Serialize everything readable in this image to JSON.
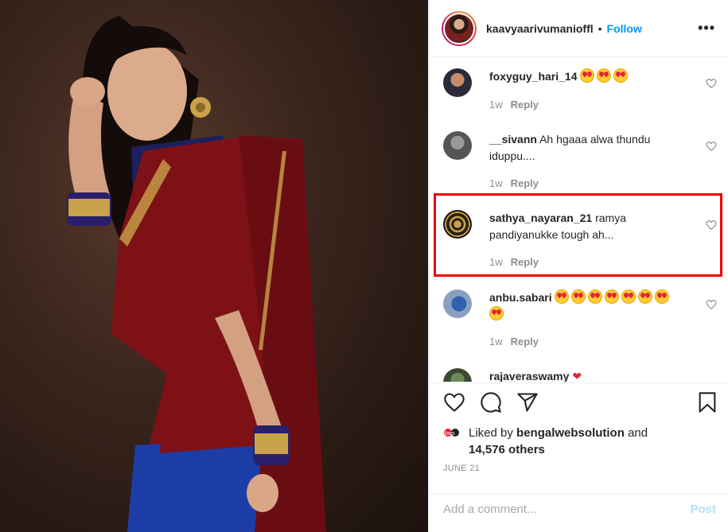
{
  "post": {
    "username": "kaavyaarivumanioffl",
    "separator": "•",
    "follow_label": "Follow",
    "more_label": "•••"
  },
  "comments": [
    {
      "username": "foxyguy_hari_14",
      "text": "",
      "emoji_count": 3,
      "time": "1w",
      "reply_label": "Reply"
    },
    {
      "username": "__sivann",
      "text": "Ah hgaaa alwa thundu iduppu....",
      "emoji_count": 0,
      "time": "1w",
      "reply_label": "Reply"
    },
    {
      "username": "sathya_nayaran_21",
      "text": "ramya pandiyanukke tough ah...",
      "emoji_count": 0,
      "time": "1w",
      "reply_label": "Reply",
      "highlighted": true
    },
    {
      "username": "anbu.sabari",
      "text": "",
      "emoji_count": 8,
      "time": "1w",
      "reply_label": "Reply"
    },
    {
      "username": "rajaveraswamy",
      "text": "",
      "emoji_count": 0,
      "time": "",
      "reply_label": ""
    }
  ],
  "likes": {
    "prefix": "Liked by",
    "liked_by_user": "bengalwebsolution",
    "conjunction": "and",
    "others": "14,576 others"
  },
  "date": "JUNE 21",
  "add_comment": {
    "placeholder": "Add a comment...",
    "post_label": "Post"
  },
  "colors": {
    "accent": "#0095f6",
    "post_disabled": "#b2dffc",
    "highlight": "#ee0000"
  },
  "icons": [
    "heart-icon",
    "comment-icon",
    "share-icon",
    "bookmark-icon",
    "more-icon"
  ]
}
